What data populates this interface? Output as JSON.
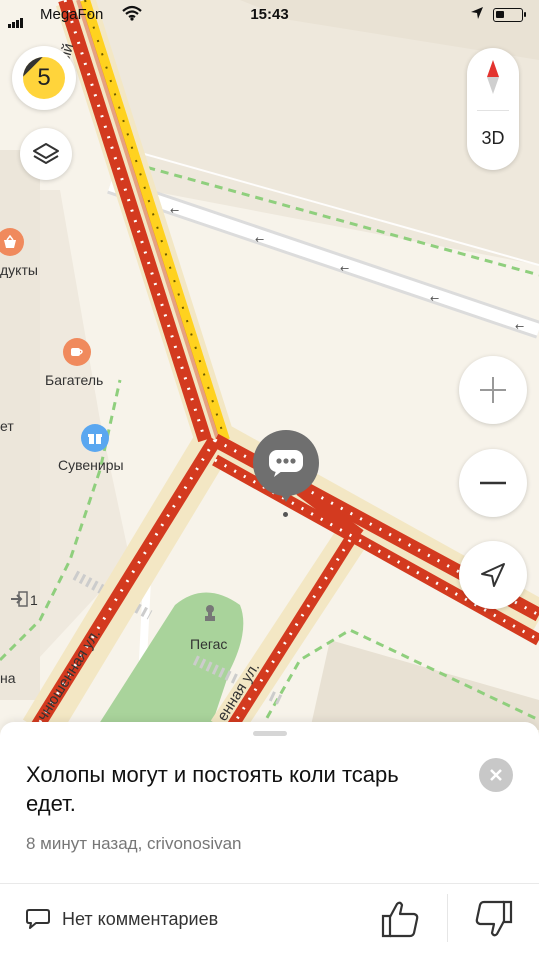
{
  "status_bar": {
    "carrier": "MegaFon",
    "time": "15:43",
    "icons": [
      "signal-icon",
      "wifi-icon",
      "location-arrow-icon",
      "battery-icon"
    ]
  },
  "map": {
    "traffic_level": "5",
    "compass_3d_label": "3D",
    "pois": [
      {
        "label": "дукты",
        "icon": "grocery-basket-icon",
        "color": "#f08a5d"
      },
      {
        "label": "Багатель",
        "icon": "coffee-cup-icon",
        "color": "#f08a5d"
      },
      {
        "label": "ет",
        "icon": "",
        "color": ""
      },
      {
        "label": "Сувениры",
        "icon": "gift-icon",
        "color": "#5aa7f0"
      },
      {
        "label": "Пегас",
        "icon": "monument-icon",
        "color": "#777777"
      },
      {
        "label": "на",
        "icon": "",
        "color": ""
      },
      {
        "label": "1",
        "icon": "exit-icon",
        "color": "#666666"
      }
    ],
    "streets": [
      {
        "label": "ченный"
      },
      {
        "label": "чнюшенная ул."
      },
      {
        "label": "енная ул."
      }
    ]
  },
  "sheet": {
    "message": "Холопы могут и постоять коли тсарь едет.",
    "meta": "8 минут назад, crivonosivan",
    "comments_label": "Нет комментариев"
  },
  "colors": {
    "traffic_red": "#d33a1f",
    "traffic_yellow": "#ffd21f",
    "traffic_badge": "#ffd43b",
    "park_green": "#a9d39b"
  }
}
